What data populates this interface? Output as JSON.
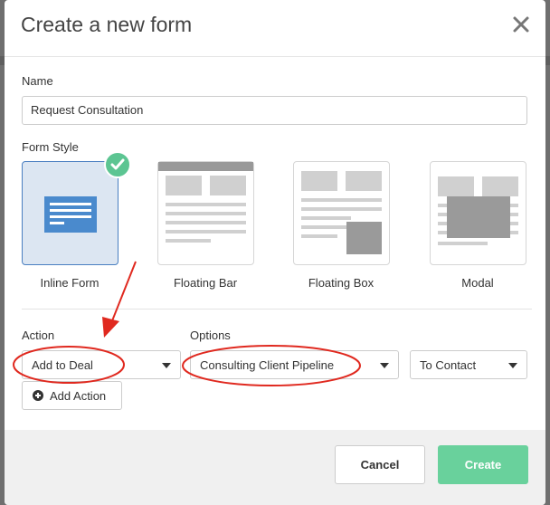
{
  "modal": {
    "title": "Create a new form",
    "close_icon": "close-icon"
  },
  "name_field": {
    "label": "Name",
    "value": "Request Consultation"
  },
  "form_style": {
    "label": "Form Style",
    "options": [
      {
        "label": "Inline Form",
        "selected": true
      },
      {
        "label": "Floating Bar",
        "selected": false
      },
      {
        "label": "Floating Box",
        "selected": false
      },
      {
        "label": "Modal",
        "selected": false
      }
    ],
    "selected_icon": "checkmark-icon"
  },
  "action": {
    "label": "Action",
    "value": "Add to Deal",
    "add_button": "Add Action",
    "add_icon": "plus-circle-icon"
  },
  "options": {
    "label": "Options",
    "pipeline": "Consulting Client Pipeline",
    "target": "To Contact"
  },
  "footer": {
    "cancel": "Cancel",
    "create": "Create"
  },
  "colors": {
    "accent_green": "#69d19c",
    "selected_blue": "#4a7fc1",
    "annotation_red": "#e0291f"
  }
}
